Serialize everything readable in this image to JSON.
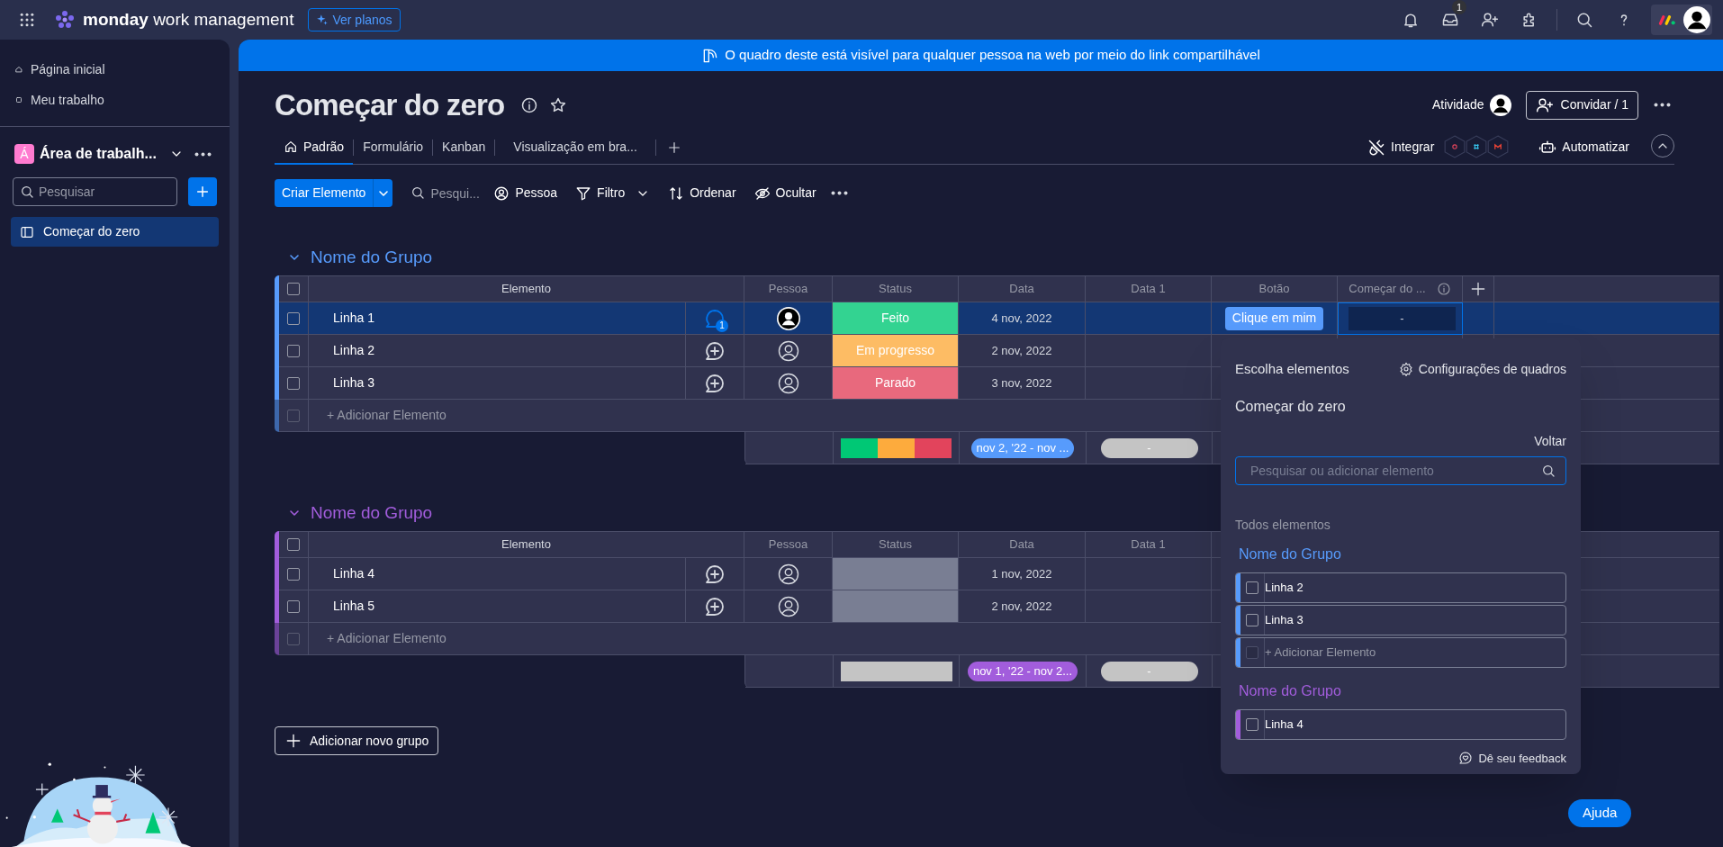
{
  "top_bar": {
    "logo": "**monday** work management",
    "upgrade_button": "Ver planos",
    "inbox_badge": "1"
  },
  "sidebar": {
    "nav": [
      {
        "label": "Página inicial"
      },
      {
        "label": "Meu trabalho"
      }
    ],
    "workspace": {
      "initial": "Á",
      "name": "Área de trabalh..."
    },
    "search": {
      "placeholder": "Pesquisar"
    },
    "boards": [
      {
        "label": "Começar do zero",
        "selected": true
      }
    ]
  },
  "banner": "O quadro deste está visível para qualquer pessoa na web por meio do link compartilhável",
  "board": {
    "title": "Começar do zero",
    "activity": "Atividade",
    "invite_button": "Convidar / 1",
    "views": [
      {
        "label": "Padrão",
        "selected": true
      },
      {
        "label": "Formulário",
        "selected": false
      },
      {
        "label": "Kanban",
        "selected": false
      },
      {
        "label": "Visualização em bra...",
        "selected": false
      }
    ],
    "integrate": "Integrar",
    "automate": "Automatizar"
  },
  "toolbar": {
    "new_item": "Criar Elemento",
    "search": {
      "placeholder": "Pesqui..."
    },
    "person": "Pessoa",
    "filter": "Filtro",
    "sort": "Ordenar",
    "hide": "Ocultar"
  },
  "groups": [
    {
      "name": "Nome do Grupo",
      "color": "#579bfc",
      "all_checked": false,
      "add_checkbox_disabled": true,
      "columns": [
        {
          "kind": "item",
          "label": "Elemento"
        },
        {
          "kind": "person",
          "label": "Pessoa"
        },
        {
          "kind": "status",
          "label": "Status"
        },
        {
          "kind": "date",
          "label": "Data"
        },
        {
          "kind": "empty",
          "label": "Data 1"
        },
        {
          "kind": "button",
          "label": "Botão"
        },
        {
          "kind": "mirror",
          "label": "Começar do ..."
        }
      ],
      "rows": [
        {
          "name": "Linha 1",
          "selected": true,
          "updates": "1",
          "assigned": true,
          "status": {
            "label": "Feito",
            "color": "#33d391"
          },
          "date": "4 nov, 2022",
          "button": "Clique em mim",
          "mirror": "-"
        },
        {
          "name": "Linha 2",
          "selected": false,
          "assigned": false,
          "status": {
            "label": "Em progresso",
            "color": "#fdbc64"
          },
          "date": "2 nov, 2022"
        },
        {
          "name": "Linha 3",
          "selected": false,
          "assigned": false,
          "status": {
            "label": "Parado",
            "color": "#e8697d"
          },
          "date": "3 nov, 2022"
        }
      ],
      "add_item": "+ Adicionar Elemento",
      "summary": {
        "status": [
          {
            "color": "#00c875"
          },
          {
            "color": "#fdab3d"
          },
          {
            "color": "#e2445c"
          }
        ],
        "date_range": "nov 2, '22 - nov ...",
        "empty_pill": "-"
      }
    },
    {
      "name": "Nome do Grupo",
      "color": "#a25ddc",
      "all_checked": false,
      "add_checkbox_disabled": true,
      "columns": [
        {
          "kind": "item",
          "label": "Elemento"
        },
        {
          "kind": "person",
          "label": "Pessoa"
        },
        {
          "kind": "status",
          "label": "Status"
        },
        {
          "kind": "date",
          "label": "Data"
        },
        {
          "kind": "empty",
          "label": "Data 1"
        }
      ],
      "rows": [
        {
          "name": "Linha 4",
          "selected": false,
          "assigned": false,
          "status": {
            "color": "#797e93"
          },
          "date": "1 nov, 2022"
        },
        {
          "name": "Linha 5",
          "selected": false,
          "assigned": false,
          "status": {
            "color": "#797e93"
          },
          "date": "2 nov, 2022"
        }
      ],
      "add_item": "+ Adicionar Elemento",
      "summary": {
        "status": [
          {
            "color": "#c4c4c4"
          }
        ],
        "date_range": "nov 1, '22 - nov 2...",
        "empty_pill": "-"
      }
    }
  ],
  "add_group": "Adicionar novo grupo",
  "picker": {
    "title": "Escolha elementos",
    "settings": "Configurações de quadros",
    "board": "Começar do zero",
    "back": "Voltar",
    "search": {
      "placeholder": "Pesquisar ou adicionar elemento"
    },
    "section": "Todos elementos",
    "groups": [
      {
        "name": "Nome do Grupo",
        "color": "#579bfc",
        "items": [
          {
            "label": "Linha 2",
            "checked": false
          },
          {
            "label": "Linha 3",
            "checked": false
          }
        ],
        "add_item": "+ Adicionar Elemento",
        "add_checkbox_disabled": true
      },
      {
        "name": "Nome do Grupo",
        "color": "#a25ddc",
        "items": [
          {
            "label": "Linha 4",
            "checked": false
          }
        ]
      }
    ],
    "feedback": "Dê seu feedback"
  },
  "help_button": "Ajuda"
}
